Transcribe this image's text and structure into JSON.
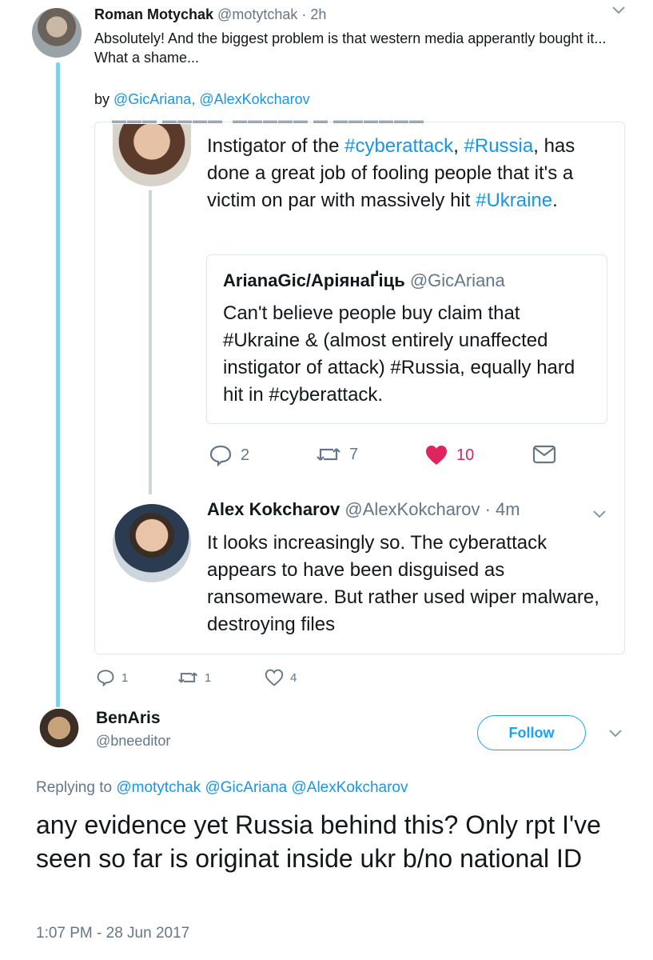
{
  "top_tweet": {
    "name": "Roman Motychak",
    "handle": "@motytchak · 2h",
    "text": "Absolutely! And the biggest problem is that western media apperantly bought it... What a shame...",
    "by_prefix": "by ",
    "by_mentions": "@GicAriana, @AlexKokcharov",
    "actions": {
      "reply_count": "1",
      "retweet_count": "1",
      "like_count": "4"
    }
  },
  "embedded": {
    "ariana_tweet": {
      "text_parts": {
        "p1": "Instigator of the ",
        "h1": "#cyberattack",
        "p2": ", ",
        "h2": "#Russia",
        "p3": ", has done a great job of fooling people that it's a victim on par with massively hit ",
        "h3": "#Ukraine",
        "p4": "."
      },
      "quote": {
        "name": "ArianaGic/АріянаҐіць",
        "handle": "@GicAriana",
        "text": "Can't believe people buy claim that #Ukraine & (almost entirely unaffected instigator of attack) #Russia, equally hard hit in #cyberattack."
      },
      "actions": {
        "reply_count": "2",
        "retweet_count": "7",
        "like_count": "10"
      }
    },
    "alex_tweet": {
      "name": "Alex Kokcharov",
      "handle": "@AlexKokcharov · 4m",
      "text": "It looks increasingly so. The cyberattack appears to have been disguised as ransomeware. But rather used wiper malware, destroying files"
    }
  },
  "main_tweet": {
    "name": "BenAris",
    "handle": "@bneeditor",
    "follow_label": "Follow",
    "replying_prefix": "Replying to ",
    "replying_mentions": "@motytchak @GicAriana @AlexKokcharov",
    "text": "any evidence yet Russia behind this? Only rpt I've seen so far is originat inside ukr b/no national ID",
    "timestamp": "1:07 PM - 28 Jun 2017"
  },
  "colors": {
    "link": "#1b95e0",
    "muted": "#657786",
    "heart": "#e0245e",
    "thread": "#7fd0ee",
    "border": "#e1e8ed"
  },
  "icons": [
    "chevron-down-icon",
    "reply-icon",
    "retweet-icon",
    "heart-icon",
    "direct-message-icon"
  ]
}
